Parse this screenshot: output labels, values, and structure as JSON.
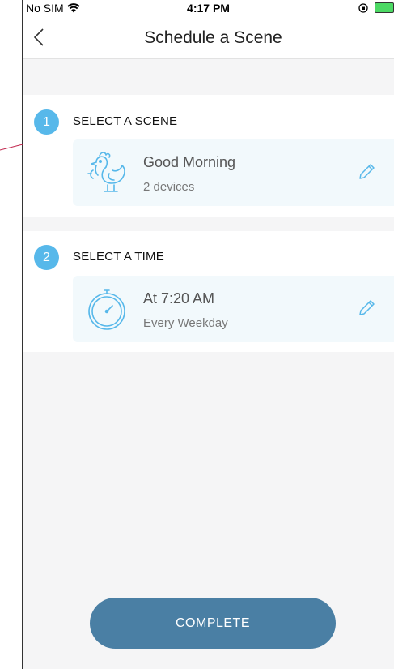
{
  "status_bar": {
    "carrier": "No SIM",
    "time": "4:17 PM"
  },
  "nav": {
    "title": "Schedule a Scene"
  },
  "steps": [
    {
      "number": "1",
      "title": "SELECT A SCENE",
      "item": {
        "icon": "chicken-icon",
        "title": "Good Morning",
        "subtitle": "2 devices"
      }
    },
    {
      "number": "2",
      "title": "SELECT A TIME",
      "item": {
        "icon": "stopwatch-icon",
        "title": "At 7:20 AM",
        "subtitle": "Every Weekday"
      }
    }
  ],
  "actions": {
    "complete_label": "COMPLETE"
  },
  "colors": {
    "accent": "#57b8ea",
    "button": "#4a7fa4",
    "card": "#f2f9fc",
    "annotation": "#c0224a"
  }
}
